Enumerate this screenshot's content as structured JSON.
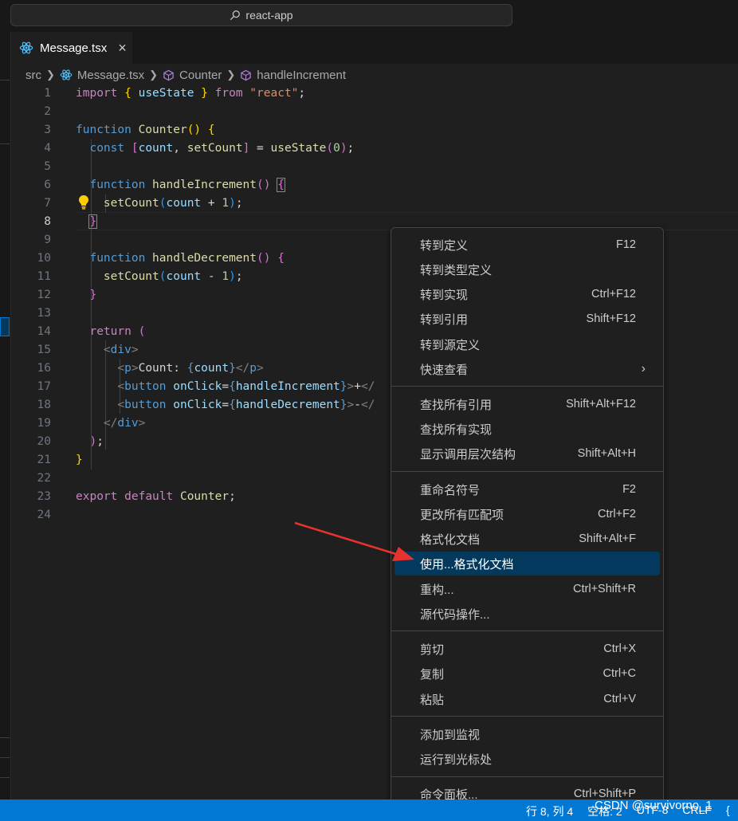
{
  "window": {
    "search_text": "react-app"
  },
  "tab": {
    "label": "Message.tsx",
    "close": "×"
  },
  "breadcrumb": {
    "items": [
      "src",
      "Message.tsx",
      "Counter",
      "handleIncrement"
    ]
  },
  "editor": {
    "line_numbers": [
      "1",
      "2",
      "3",
      "4",
      "5",
      "6",
      "7",
      "8",
      "9",
      "10",
      "11",
      "12",
      "13",
      "14",
      "15",
      "16",
      "17",
      "18",
      "19",
      "20",
      "21",
      "22",
      "23",
      "24"
    ],
    "active_line": "8"
  },
  "context_menu": {
    "items": [
      {
        "label": "转到定义",
        "key": "F12"
      },
      {
        "label": "转到类型定义",
        "key": ""
      },
      {
        "label": "转到实现",
        "key": "Ctrl+F12"
      },
      {
        "label": "转到引用",
        "key": "Shift+F12"
      },
      {
        "label": "转到源定义",
        "key": ""
      },
      {
        "label": "快速查看",
        "key": ""
      },
      {
        "label": "查找所有引用",
        "key": "Shift+Alt+F12"
      },
      {
        "label": "查找所有实现",
        "key": ""
      },
      {
        "label": "显示调用层次结构",
        "key": "Shift+Alt+H"
      },
      {
        "label": "重命名符号",
        "key": "F2"
      },
      {
        "label": "更改所有匹配项",
        "key": "Ctrl+F2"
      },
      {
        "label": "格式化文档",
        "key": "Shift+Alt+F"
      },
      {
        "label": "使用...格式化文档",
        "key": ""
      },
      {
        "label": "重构...",
        "key": "Ctrl+Shift+R"
      },
      {
        "label": "源代码操作...",
        "key": ""
      },
      {
        "label": "剪切",
        "key": "Ctrl+X"
      },
      {
        "label": "复制",
        "key": "Ctrl+C"
      },
      {
        "label": "粘贴",
        "key": "Ctrl+V"
      },
      {
        "label": "添加到监视",
        "key": ""
      },
      {
        "label": "运行到光标处",
        "key": ""
      },
      {
        "label": "命令面板...",
        "key": "Ctrl+Shift+P"
      }
    ],
    "submenu_arrow": "›"
  },
  "status_bar": {
    "items": [
      "行 8, 列 4",
      "空格: 2",
      "UTF-8",
      "CRLF",
      "{"
    ]
  },
  "watermark": "CSDN @survivorno_1",
  "colors": {
    "accent": "#0078d4",
    "menu_highlight": "#04395e",
    "annotation_arrow": "#e8322e"
  },
  "icons": [
    "search-icon",
    "react-icon",
    "close-icon",
    "symbol-icon",
    "lightbulb-icon",
    "chevron-right-icon"
  ]
}
